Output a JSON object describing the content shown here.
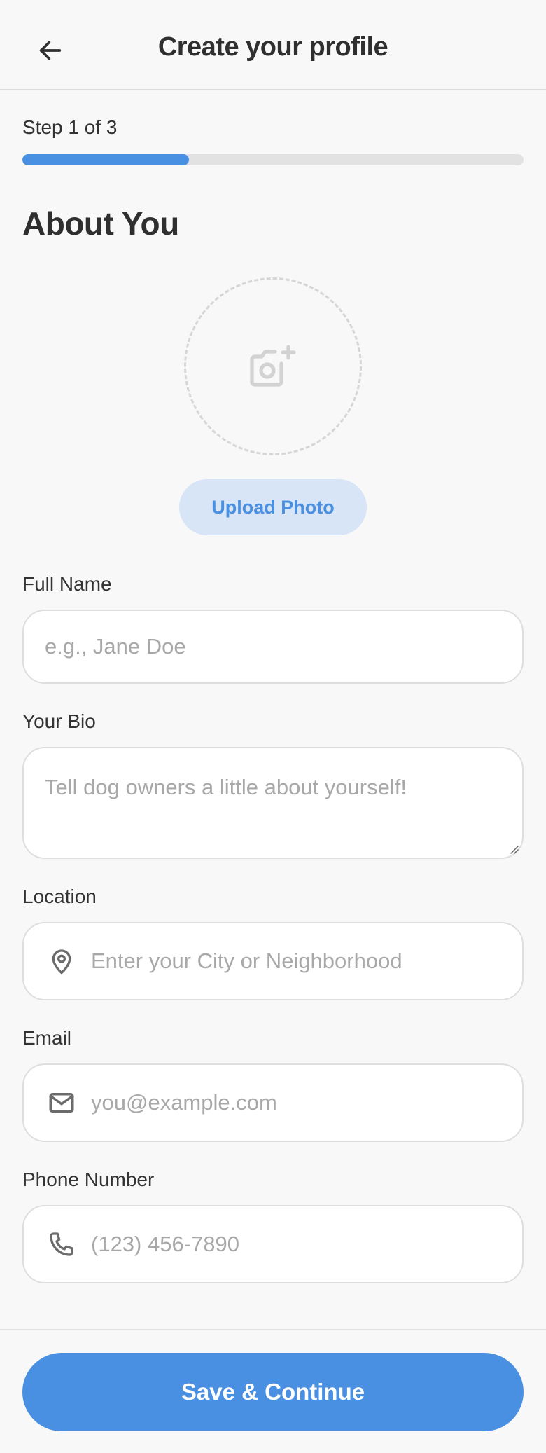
{
  "header": {
    "title": "Create your profile",
    "back_icon": "arrow-left-icon"
  },
  "progress": {
    "step_label": "Step 1 of 3",
    "fraction": 0.333,
    "color": "#4a90e2"
  },
  "section": {
    "title": "About You"
  },
  "photo": {
    "icon": "camera-add-icon",
    "upload_label": "Upload Photo"
  },
  "fields": {
    "full_name": {
      "label": "Full Name",
      "value": "",
      "placeholder": "e.g., Jane Doe"
    },
    "bio": {
      "label": "Your Bio",
      "value": "",
      "placeholder": "Tell dog owners a little about yourself!"
    },
    "location": {
      "label": "Location",
      "value": "",
      "placeholder": "Enter your City or Neighborhood",
      "icon": "map-pin-icon"
    },
    "email": {
      "label": "Email",
      "value": "",
      "placeholder": "you@example.com",
      "icon": "mail-icon"
    },
    "phone": {
      "label": "Phone Number",
      "value": "",
      "placeholder": "(123) 456-7890",
      "icon": "phone-icon"
    }
  },
  "footer": {
    "save_label": "Save & Continue"
  },
  "colors": {
    "accent": "#4a90e2",
    "accent_light": "#d7e5f6",
    "background": "#f8f8f8"
  }
}
